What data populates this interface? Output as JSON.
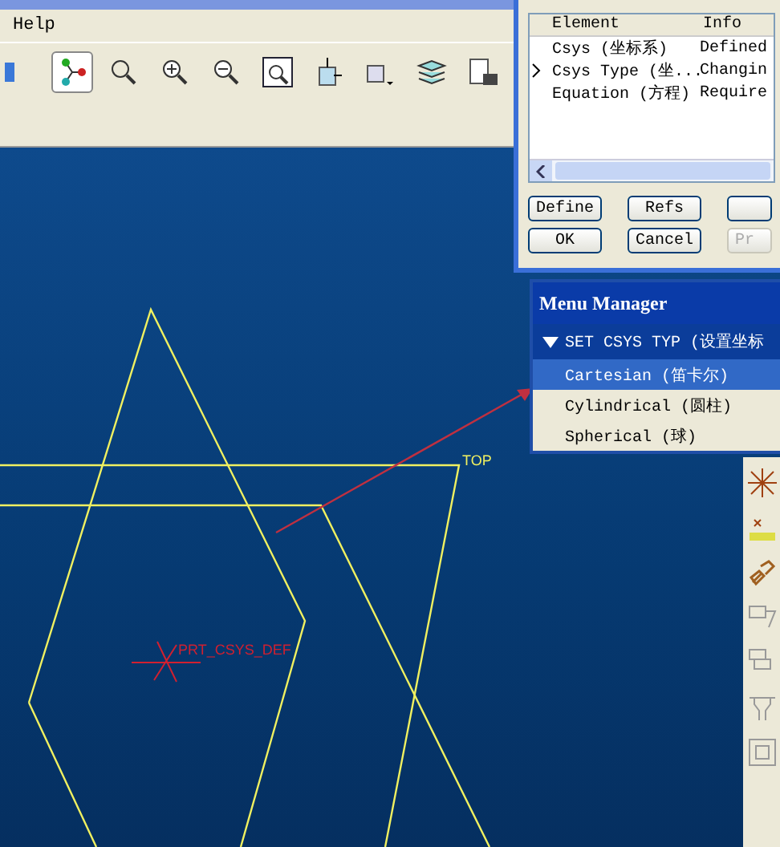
{
  "menu_bar": {
    "items": [
      "Help"
    ]
  },
  "dialog": {
    "columns": [
      "Element",
      "Info"
    ],
    "rows": [
      {
        "element": "Csys (坐标系)",
        "info": "Defined",
        "current": false
      },
      {
        "element": "Csys Type (坐...",
        "info": "Changin",
        "current": true
      },
      {
        "element": "Equation (方程)",
        "info": "Require",
        "current": false
      }
    ],
    "buttons": [
      {
        "label": "Define",
        "disabled": false
      },
      {
        "label": "Refs",
        "disabled": false
      },
      {
        "disabled": false
      },
      {
        "label": "OK",
        "disabled": false
      },
      {
        "label": "Cancel",
        "disabled": false
      },
      {
        "label": "Pr",
        "disabled": true
      }
    ]
  },
  "menu_manager": {
    "title": "Menu Manager",
    "section": "SET CSYS TYP (设置坐标",
    "items": [
      {
        "label": "Cartesian (笛卡尔)",
        "selected": true
      },
      {
        "label": "Cylindrical (圆柱)",
        "selected": false
      },
      {
        "label": "Spherical (球)",
        "selected": false
      }
    ]
  },
  "canvas": {
    "plane_label": "TOP",
    "csys_label": "PRT_CSYS_DEF"
  }
}
